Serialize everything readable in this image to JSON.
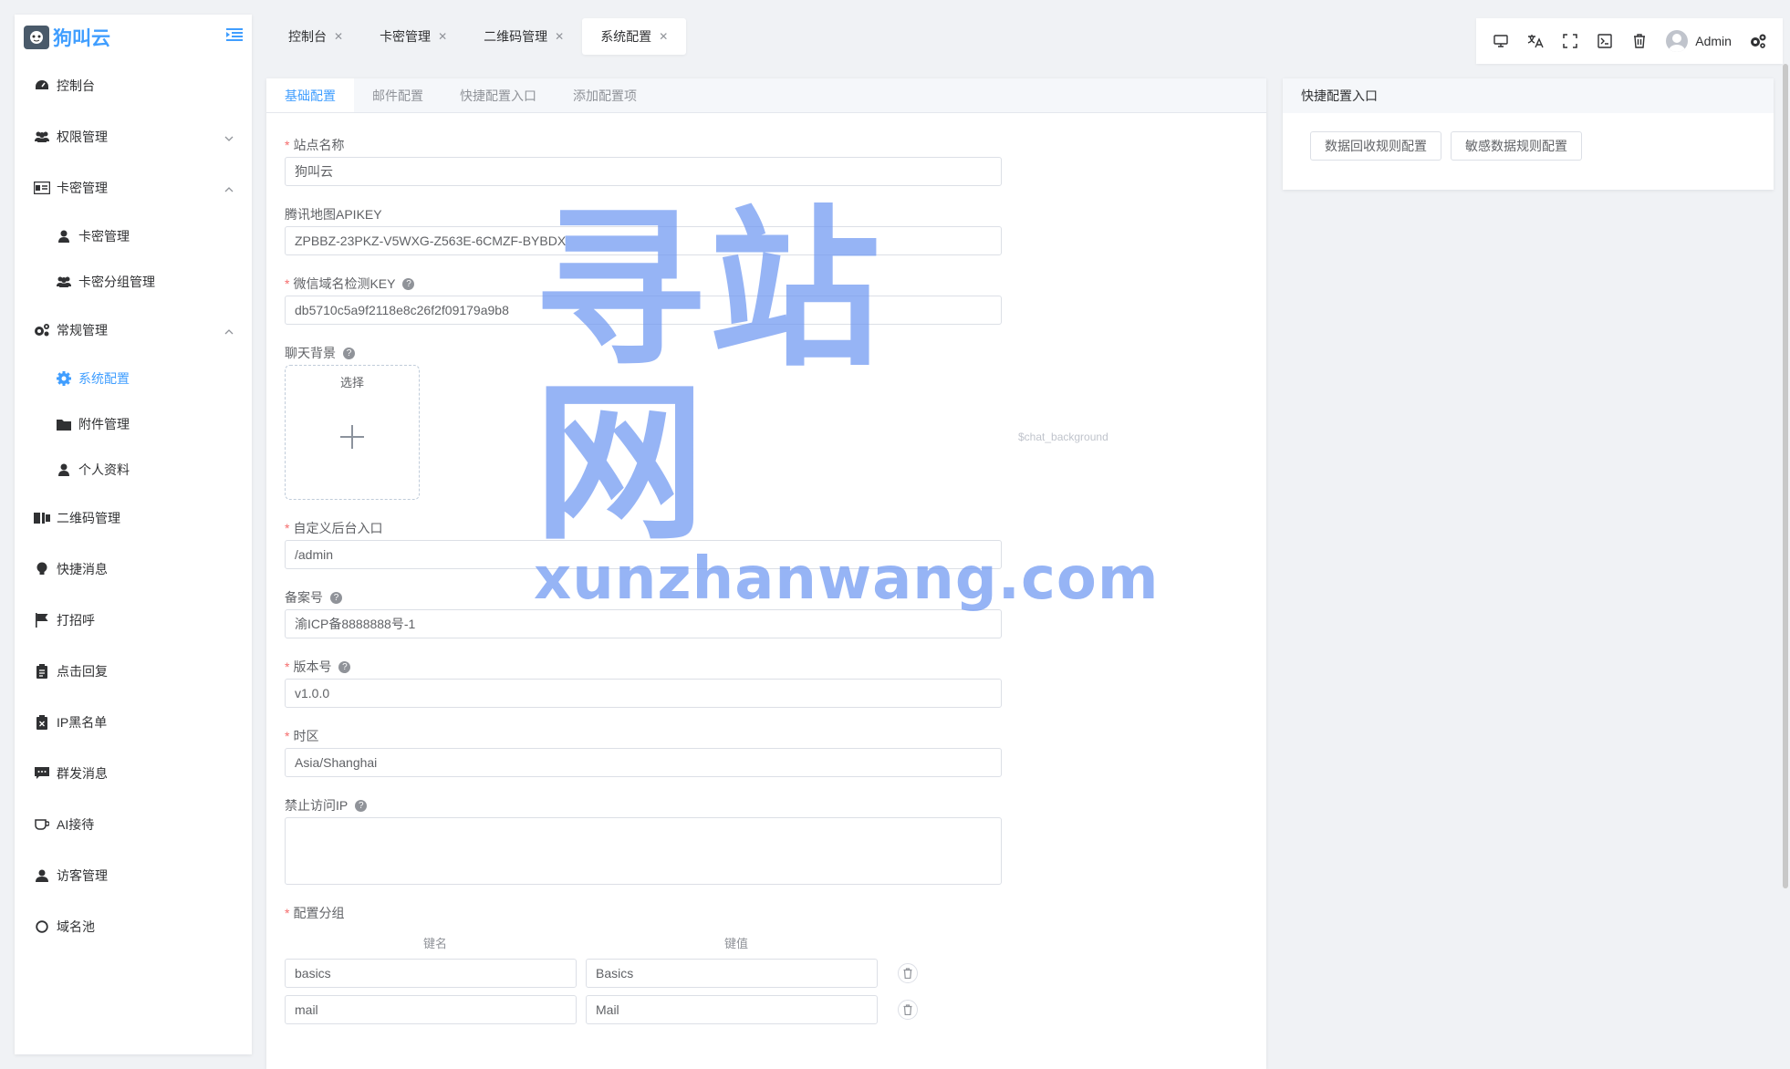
{
  "app": {
    "title": "狗叫云"
  },
  "sidebar": {
    "items": [
      {
        "label": "控制台",
        "icon": "dashboard-icon"
      },
      {
        "label": "权限管理",
        "icon": "users-icon",
        "arrow": "chevron-down"
      },
      {
        "label": "卡密管理",
        "icon": "id-card-icon",
        "arrow": "chevron-up"
      },
      {
        "label": "卡密管理",
        "icon": "user-icon",
        "sub": true
      },
      {
        "label": "卡密分组管理",
        "icon": "users-icon",
        "sub": true
      },
      {
        "label": "常规管理",
        "icon": "cogs-icon",
        "arrow": "chevron-up"
      },
      {
        "label": "系统配置",
        "icon": "gear-icon",
        "sub": true,
        "active": true
      },
      {
        "label": "附件管理",
        "icon": "folder-icon",
        "sub": true
      },
      {
        "label": "个人资料",
        "icon": "user-icon",
        "sub": true
      },
      {
        "label": "二维码管理",
        "icon": "qrcode-icon"
      },
      {
        "label": "快捷消息",
        "icon": "bulb-icon"
      },
      {
        "label": "打招呼",
        "icon": "flag-icon"
      },
      {
        "label": "点击回复",
        "icon": "clipboard-icon"
      },
      {
        "label": "IP黑名单",
        "icon": "blacklist-icon"
      },
      {
        "label": "群发消息",
        "icon": "chat-icon"
      },
      {
        "label": "AI接待",
        "icon": "cup-icon"
      },
      {
        "label": "访客管理",
        "icon": "visitor-icon"
      },
      {
        "label": "域名池",
        "icon": "circle-icon"
      }
    ]
  },
  "tabs": [
    {
      "label": "控制台"
    },
    {
      "label": "卡密管理"
    },
    {
      "label": "二维码管理"
    },
    {
      "label": "系统配置",
      "active": true
    }
  ],
  "toolbar": {
    "user": "Admin"
  },
  "main": {
    "tabs": [
      "基础配置",
      "邮件配置",
      "快捷配置入口",
      "添加配置项"
    ],
    "fields": {
      "site_name": {
        "label": "站点名称",
        "value": "狗叫云"
      },
      "map_key": {
        "label": "腾讯地图APIKEY",
        "value": "ZPBBZ-23PKZ-V5WXG-Z563E-6CMZF-BYBDX"
      },
      "wx_key": {
        "label": "微信域名检测KEY",
        "value": "db5710c5a9f2118e8c26f2f09179a9b8"
      },
      "chat_bg": {
        "label": "聊天背景",
        "button": "选择",
        "hint": "$chat_background"
      },
      "admin_entry": {
        "label": "自定义后台入口",
        "value": "/admin"
      },
      "icp": {
        "label": "备案号",
        "value": "渝ICP备8888888号-1"
      },
      "version": {
        "label": "版本号",
        "value": "v1.0.0"
      },
      "timezone": {
        "label": "时区",
        "value": "Asia/Shanghai"
      },
      "forbidden_ip": {
        "label": "禁止访问IP",
        "value": ""
      },
      "config_group": {
        "label": "配置分组",
        "key_header": "键名",
        "value_header": "键值",
        "rows": [
          {
            "key": "basics",
            "value": "Basics"
          },
          {
            "key": "mail",
            "value": "Mail"
          }
        ]
      }
    }
  },
  "side_panel": {
    "title": "快捷配置入口",
    "buttons": [
      "数据回收规则配置",
      "敏感数据规则配置"
    ]
  },
  "watermark": {
    "big": "寻站网",
    "small": "xunzhanwang.com"
  },
  "colors": {
    "accent": "#409eff",
    "required": "#f56c6c",
    "watermark": "#6f98f2"
  }
}
